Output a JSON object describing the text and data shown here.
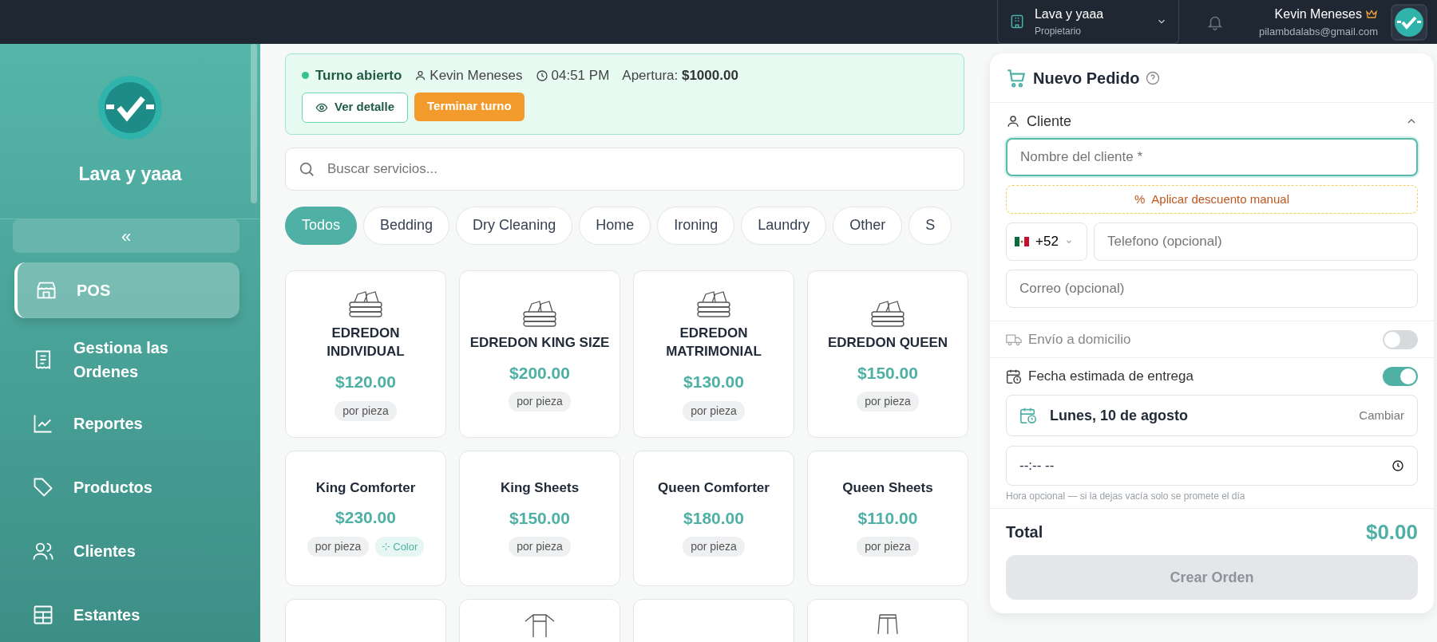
{
  "topbar": {
    "org": {
      "name": "Lava y yaaa",
      "role": "Propietario"
    },
    "user": {
      "name": "Kevin Meneses",
      "email": "pilambdalabs@gmail.com"
    }
  },
  "sidebar": {
    "brand": "Lava y yaaa",
    "collapse": "«",
    "items": [
      {
        "label": "POS",
        "kind": "store",
        "selected": true
      },
      {
        "label": "Gestiona las Ordenes",
        "kind": "receipt",
        "selected": false
      },
      {
        "label": "Reportes",
        "kind": "chart",
        "selected": false
      },
      {
        "label": "Productos",
        "kind": "tag",
        "selected": false
      },
      {
        "label": "Clientes",
        "kind": "users",
        "selected": false
      },
      {
        "label": "Estantes",
        "kind": "table",
        "selected": false
      }
    ]
  },
  "shift": {
    "status": "Turno abierto",
    "user": "Kevin Meneses",
    "time": "04:51 PM",
    "opening_label": "Apertura:",
    "opening_amount": "$1000.00",
    "detail_button": "Ver detalle",
    "end_button": "Terminar turno"
  },
  "search": {
    "placeholder": "Buscar servicios..."
  },
  "categories": [
    {
      "label": "Todos",
      "selected": true
    },
    {
      "label": "Bedding",
      "selected": false
    },
    {
      "label": "Dry Cleaning",
      "selected": false
    },
    {
      "label": "Home",
      "selected": false
    },
    {
      "label": "Ironing",
      "selected": false
    },
    {
      "label": "Laundry",
      "selected": false
    },
    {
      "label": "Other",
      "selected": false
    },
    {
      "label": "S",
      "selected": false
    }
  ],
  "products": [
    {
      "name": "EDREDON INDIVIDUAL",
      "price": "$120.00",
      "unit": "por pieza",
      "kind": "folded"
    },
    {
      "name": "EDREDON KING SIZE",
      "price": "$200.00",
      "unit": "por pieza",
      "kind": "folded"
    },
    {
      "name": "EDREDON MATRIMONIAL",
      "price": "$130.00",
      "unit": "por pieza",
      "kind": "folded"
    },
    {
      "name": "EDREDON QUEEN",
      "price": "$150.00",
      "unit": "por pieza",
      "kind": "folded"
    },
    {
      "name": "King Comforter",
      "price": "$230.00",
      "unit": "por pieza",
      "tag": "Color",
      "kind": "plain"
    },
    {
      "name": "King Sheets",
      "price": "$150.00",
      "unit": "por pieza",
      "kind": "plain"
    },
    {
      "name": "Queen Comforter",
      "price": "$180.00",
      "unit": "por pieza",
      "kind": "plain"
    },
    {
      "name": "Queen Sheets",
      "price": "$110.00",
      "unit": "por pieza",
      "kind": "plain"
    }
  ],
  "partial_products": [
    {
      "kind": "plain"
    },
    {
      "kind": "shirt"
    },
    {
      "kind": "plain"
    },
    {
      "kind": "pants"
    }
  ],
  "order": {
    "title": "Nuevo Pedido",
    "client_section": {
      "label": "Cliente",
      "expanded": true
    },
    "name_placeholder": "Nombre del cliente *",
    "discount_icon": "%",
    "discount": "Aplicar descuento manual",
    "country_code": "+52",
    "phone_placeholder": "Telefono (opcional)",
    "email_placeholder": "Correo (opcional)",
    "delivery": {
      "label": "Envío a domicilio",
      "on": false
    },
    "due_date": {
      "label": "Fecha estimada de entrega",
      "on": true,
      "date": "Lunes, 10 de agosto",
      "change": "Cambiar",
      "time": "--:-- --",
      "hint": "Hora opcional — si la dejas vacía solo se promete el día"
    },
    "total_label": "Total",
    "total": "$0.00",
    "submit": {
      "label": "Crear Orden",
      "disabled": true
    }
  }
}
